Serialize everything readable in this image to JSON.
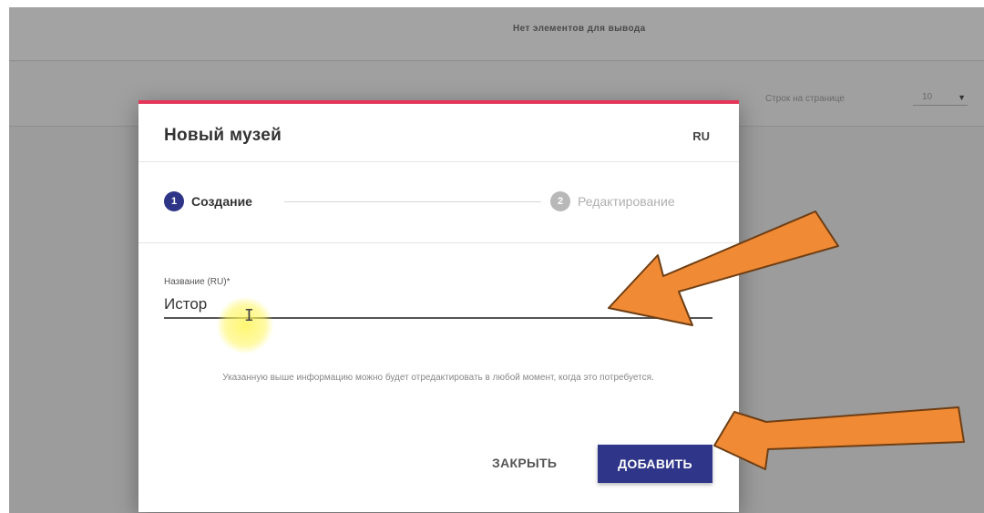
{
  "background": {
    "no_items_text": "Нет элементов для вывода",
    "rows_per_page_label": "Строк на странице",
    "rows_per_page_value": "10"
  },
  "modal": {
    "title": "Новый музей",
    "lang_toggle": "RU",
    "accent_color": "#e5365a",
    "steps": [
      {
        "number": "1",
        "label": "Создание",
        "state": "active"
      },
      {
        "number": "2",
        "label": "Редактирование",
        "state": "inactive"
      }
    ],
    "field": {
      "label": "Название (RU)*",
      "value": "Истор"
    },
    "helper_text": "Указанную выше информацию можно будет отредактировать в любой момент, когда это потребуется.",
    "buttons": {
      "close": "ЗАКРЫТЬ",
      "add": "ДОБАВИТЬ"
    },
    "primary_color": "#2f3589"
  },
  "annotations": {
    "arrow_color": "#f08a35",
    "arrow_count": 2
  }
}
